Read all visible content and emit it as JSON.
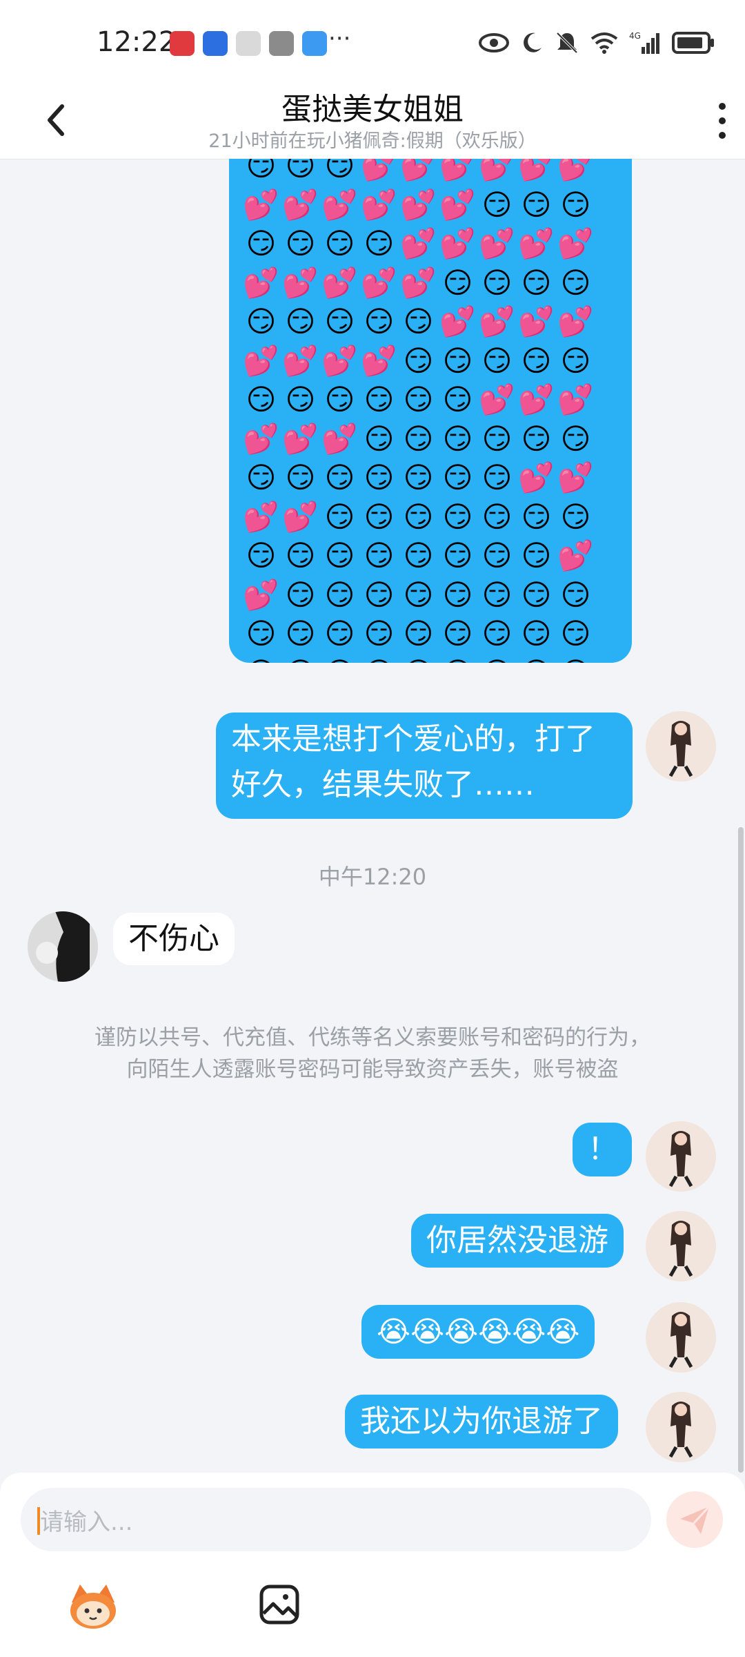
{
  "status_bar": {
    "time": "12:22",
    "more": "···",
    "network": "4G"
  },
  "header": {
    "title": "蛋挞美女姐姐",
    "subtitle": "21小时前在玩小猪佩奇:假期（欢乐版）"
  },
  "emoji_art": [
    "😏😏😏💕💕💕💕💕💕",
    "💕💕💕💕💕💕😏😏😏",
    "😏😏😏😏💕💕💕💕💕",
    "💕💕💕💕💕😏😏😏😏",
    "😏😏😏😏😏💕💕💕💕",
    "💕💕💕💕😏😏😏😏😏",
    "😏😏😏😏😏😏💕💕💕",
    "💕💕💕😏😏😏😏😏😏",
    "😏😏😏😏😏😏😏💕💕",
    "💕💕😏😏😏😏😏😏😏",
    "😏😏😏😏😏😏😏😏💕",
    "💕😏😏😏😏😏😏😏😏",
    "😏😏😏😏😏😏😏😏😏",
    "😏😏😏😏😏😏😏😏😏"
  ],
  "messages": {
    "msg1_line1": "本来是想打个爱心的，打了",
    "msg1_line2": "好久，结果失败了……",
    "time_label": "中午12:20",
    "peer_msg": "不伤心",
    "warning_line1": "谨防以共号、代充值、代练等名义索要账号和密码的行为，",
    "warning_line2": "向陌生人透露账号密码可能导致资产丢失，账号被盗",
    "msg2": "！",
    "msg3": "你居然没退游",
    "msg4": "😭😭😭😭😭😭",
    "msg5": "我还以为你退游了"
  },
  "composer": {
    "placeholder": "请输入..."
  },
  "colors": {
    "bubble_blue": "#2ab0f5",
    "background": "#f2f4f7"
  },
  "icons": [
    "back-icon",
    "more-vertical-icon",
    "send-icon",
    "mascot-icon",
    "image-icon"
  ]
}
